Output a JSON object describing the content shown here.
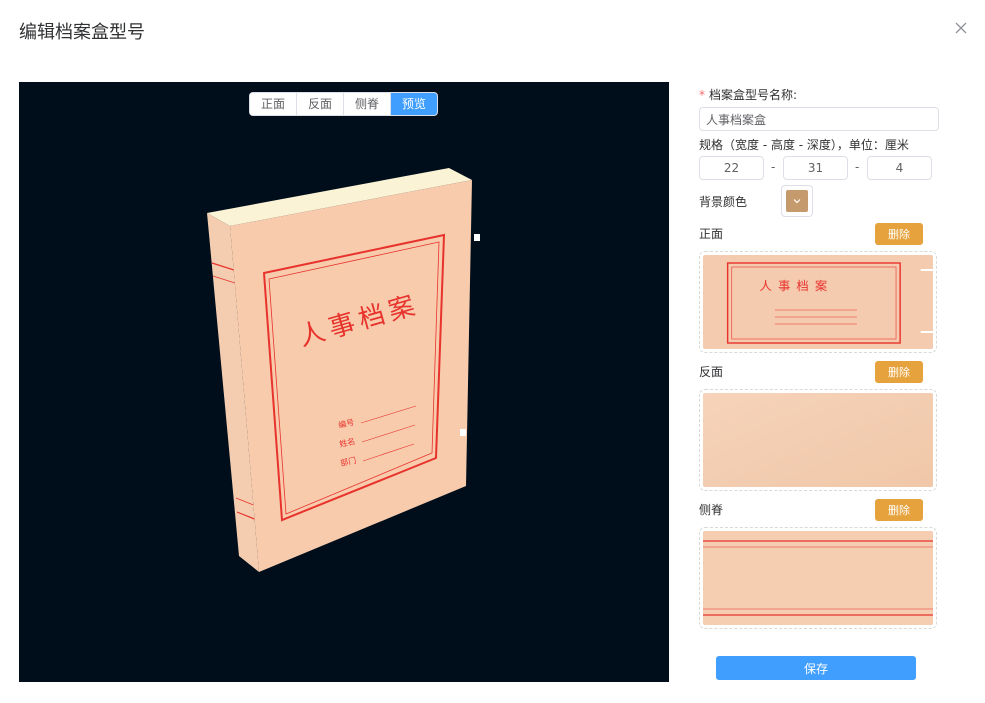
{
  "dialog": {
    "title": "编辑档案盒型号",
    "close_icon": "close-icon"
  },
  "viewer": {
    "tabs": [
      {
        "label": "正面",
        "active": false
      },
      {
        "label": "反面",
        "active": false
      },
      {
        "label": "侧脊",
        "active": false
      },
      {
        "label": "预览",
        "active": true
      }
    ],
    "background_color": "#000d1a",
    "box_cover": {
      "title": "人事档案",
      "fields": [
        "编号",
        "姓名",
        "部门"
      ]
    }
  },
  "form": {
    "name_required_mark": "*",
    "name_label": "档案盒型号名称:",
    "name_value": "人事档案盒",
    "spec_label": "规格（宽度 - 高度 - 深度），单位：厘米",
    "width": "22",
    "height": "31",
    "depth": "4",
    "separator": "-",
    "bg_color_label": "背景颜色",
    "bg_color": "#c59a6d",
    "sections": [
      {
        "label": "正面",
        "delete_label": "删除",
        "texture_title": "人事档案"
      },
      {
        "label": "反面",
        "delete_label": "删除"
      },
      {
        "label": "侧脊",
        "delete_label": "删除"
      }
    ],
    "save_label": "保存"
  },
  "colors": {
    "primary": "#409eff",
    "warning": "#e6a23c",
    "kraft": "#f2c9a8",
    "kraft_light": "#f7d5bb",
    "red_ink": "#e8332d"
  }
}
